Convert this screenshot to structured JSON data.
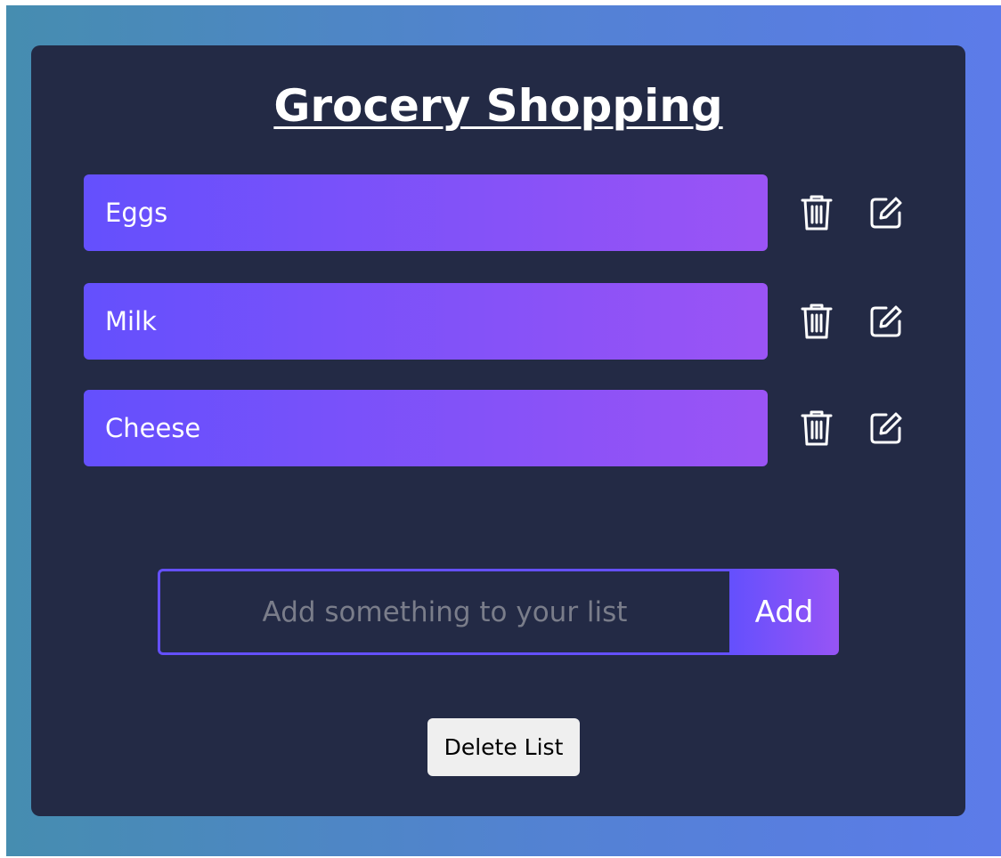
{
  "list": {
    "title": "Grocery Shopping",
    "items": [
      {
        "label": "Eggs",
        "delete_icon": "trash-icon",
        "edit_icon": "edit-icon"
      },
      {
        "label": "Milk",
        "delete_icon": "trash-icon",
        "edit_icon": "edit-icon"
      },
      {
        "label": "Cheese",
        "delete_icon": "trash-icon",
        "edit_icon": "edit-icon"
      }
    ]
  },
  "add_form": {
    "placeholder": "Add something to your list",
    "value": "",
    "button_label": "Add"
  },
  "actions": {
    "delete_list_label": "Delete List"
  },
  "colors": {
    "card_background": "#232a45",
    "item_gradient_start": "#6450fd",
    "item_gradient_end": "#9b54f5",
    "page_gradient_start": "#468db0",
    "page_gradient_end": "#5c7be9"
  }
}
